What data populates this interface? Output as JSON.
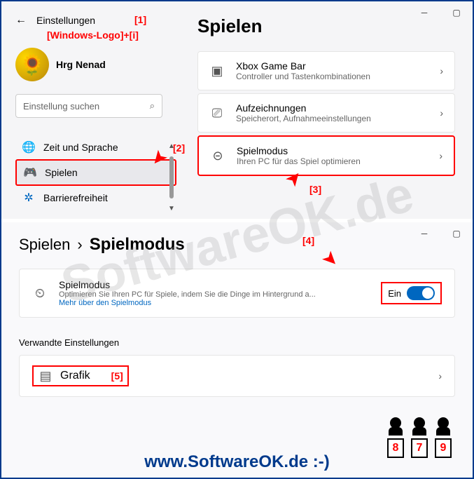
{
  "watermark": "SoftwareOK.de",
  "footer": "www.SoftwareOK.de :-)",
  "annotations": {
    "a1": "[1]",
    "hotkey": "[Windows-Logo]+[i]",
    "a2": "[2]",
    "a3": "[3]",
    "a4": "[4]",
    "a5": "[5]"
  },
  "win1": {
    "back": "←",
    "settings": "Einstellungen",
    "user": "Hrg Nenad",
    "search_placeholder": "Einstellung suchen",
    "nav": {
      "time": "Zeit und Sprache",
      "gaming": "Spielen",
      "accessibility": "Barrierefreiheit"
    },
    "title": "Spielen",
    "cards": {
      "xbox": {
        "title": "Xbox Game Bar",
        "sub": "Controller und Tastenkombinationen"
      },
      "rec": {
        "title": "Aufzeichnungen",
        "sub": "Speicherort, Aufnahmeeinstellungen"
      },
      "gamemode": {
        "title": "Spielmodus",
        "sub": "Ihren PC für das Spiel optimieren"
      }
    }
  },
  "win2": {
    "crumb_parent": "Spielen",
    "crumb_sep": "›",
    "crumb_current": "Spielmodus",
    "card": {
      "title": "Spielmodus",
      "sub": "Optimieren Sie Ihren PC für Spiele, indem Sie die Dinge im Hintergrund a...",
      "link": "Mehr über den Spielmodus"
    },
    "toggle_label": "Ein",
    "related": "Verwandte Einstellungen",
    "grafik": "Grafik"
  },
  "judges": {
    "s1": "8",
    "s2": "7",
    "s3": "9"
  }
}
